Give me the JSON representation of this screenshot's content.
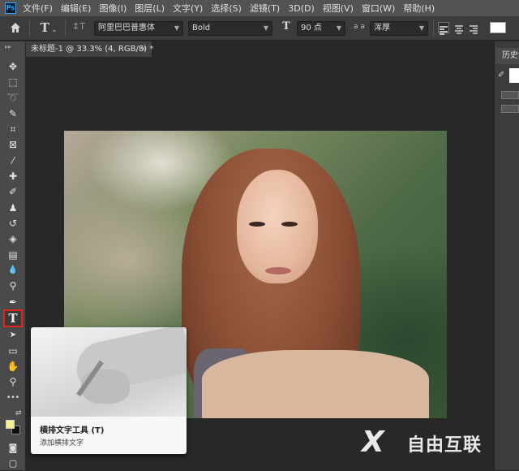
{
  "app": {
    "logo": "Ps"
  },
  "menu": [
    "文件(F)",
    "编辑(E)",
    "图像(I)",
    "图层(L)",
    "文字(Y)",
    "选择(S)",
    "滤镜(T)",
    "3D(D)",
    "视图(V)",
    "窗口(W)",
    "帮助(H)"
  ],
  "options": {
    "home_icon": "home-icon",
    "tool_glyph": "T",
    "orient_glyph": "↕T",
    "font_family": "阿里巴巴普惠体",
    "font_style": "Bold",
    "size_glyph": "T",
    "font_size": "90 点",
    "aa_glyph": "a a",
    "antialias": "浑厚"
  },
  "document_tab": {
    "title": "未标题-1 @ 33.3% (4, RGB/8) *",
    "close": "×"
  },
  "tools": [
    {
      "name": "move-tool",
      "glyph": "✥"
    },
    {
      "name": "marquee-tool",
      "glyph": "⬚"
    },
    {
      "name": "lasso-tool",
      "glyph": "➰"
    },
    {
      "name": "magic-wand-tool",
      "glyph": "✎"
    },
    {
      "name": "crop-tool",
      "glyph": "⌗"
    },
    {
      "name": "frame-tool",
      "glyph": "⊠"
    },
    {
      "name": "eyedropper-tool",
      "glyph": "⁄"
    },
    {
      "name": "healing-brush-tool",
      "glyph": "✚"
    },
    {
      "name": "brush-tool",
      "glyph": "✐"
    },
    {
      "name": "clone-stamp-tool",
      "glyph": "♟"
    },
    {
      "name": "history-brush-tool",
      "glyph": "↺"
    },
    {
      "name": "eraser-tool",
      "glyph": "◈"
    },
    {
      "name": "gradient-tool",
      "glyph": "▤"
    },
    {
      "name": "blur-tool",
      "glyph": "💧"
    },
    {
      "name": "dodge-tool",
      "glyph": "⚲"
    },
    {
      "name": "pen-tool",
      "glyph": "✒"
    },
    {
      "name": "text-tool",
      "glyph": "T"
    },
    {
      "name": "path-selection-tool",
      "glyph": "➤"
    },
    {
      "name": "rectangle-tool",
      "glyph": "▭"
    },
    {
      "name": "hand-tool",
      "glyph": "✋"
    },
    {
      "name": "zoom-tool",
      "glyph": "⚲"
    },
    {
      "name": "more-tools",
      "glyph": "•••"
    }
  ],
  "colors": {
    "foreground": "#f5f08a",
    "background": "#111111",
    "highlight": "#e2231a"
  },
  "right_panel": {
    "tab": "历史记"
  },
  "tooltip": {
    "title": "横排文字工具 (T)",
    "description": "添加横排文字"
  },
  "watermark": {
    "logo": "X",
    "text": "自由互联"
  }
}
